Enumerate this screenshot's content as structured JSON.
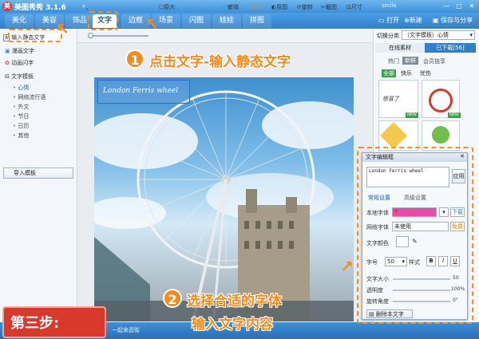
{
  "app": {
    "title": "美图秀秀 3.1.6",
    "user": "smile",
    "min": "—",
    "max": "□",
    "close": "✕"
  },
  "tabs": [
    "美化",
    "美容",
    "饰品",
    "文字",
    "边框",
    "场景",
    "闪图",
    "娃娃",
    "拼图"
  ],
  "active_tab": "文字",
  "top_actions": {
    "open": "打开",
    "new": "新建",
    "save": "保存与分享"
  },
  "left_panel": {
    "static_text": "输入静态文字",
    "anim_text": "漫画文字",
    "flash_text": "动画闪字",
    "templates": "文字模板",
    "template_items": [
      "心情",
      "网络流行语",
      "外文",
      "节日",
      "日历",
      "其他"
    ],
    "import": "导入模板"
  },
  "toolbar": {
    "orig_size": "原大",
    "undo": "撤销",
    "redo": "重做",
    "original": "原图",
    "rotate": "旋转",
    "crop": "截图",
    "size": "尺寸"
  },
  "canvas": {
    "text": "London Ferris wheel"
  },
  "right_panel": {
    "category_label": "切换分类",
    "category_value": "（文字模板）心情",
    "online_tab": "在线素材",
    "downloaded_tab": "已下载[56]",
    "filters": [
      "热门",
      "新鲜",
      "会员独享"
    ],
    "subfilters": [
      "全部",
      "快乐",
      "忧伤"
    ]
  },
  "dialog": {
    "title": "文字编辑框",
    "input_value": "London Ferris wheel",
    "apply": "应用",
    "tabs": [
      "常规设置",
      "高级设置"
    ],
    "local_font_label": "本地字体",
    "download": "下载",
    "net_font_label": "网络字体",
    "net_font_value": "未使用",
    "free": "免费",
    "color_label": "文字颜色",
    "size_label": "字号",
    "size_value": "50",
    "style_label": "样式",
    "bold": "B",
    "italic": "I",
    "underline": "U",
    "text_size_label": "文字大小",
    "text_size_value": "50",
    "opacity_label": "透明度",
    "opacity_value": "100%",
    "rotate_label": "旋转角度",
    "rotate_value": "0°",
    "delete": "删除本文字"
  },
  "annotations": {
    "step1_num": "1",
    "step1_text": "点击文字-输入静态文字",
    "step2_num": "2",
    "step2_line1": "选择合适的字体",
    "step2_line2": "输入文字内容",
    "step_badge": "第三步:"
  },
  "status": {
    "tip": "一起来逛街"
  },
  "colors": {
    "accent": "#f48b1a",
    "title_blue": "#3b8fd8",
    "step_red": "#d9392a"
  }
}
